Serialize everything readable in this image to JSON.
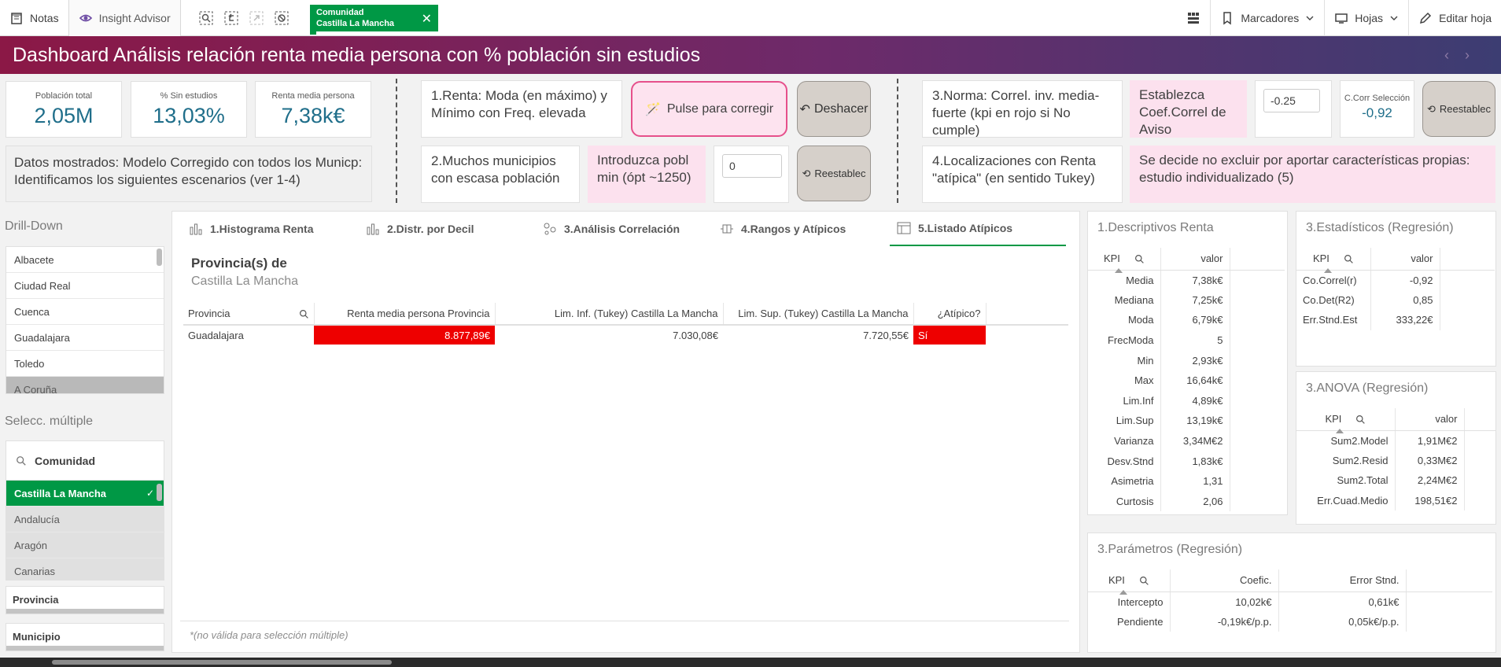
{
  "toolbar": {
    "notes_label": "Notas",
    "insight_label": "Insight Advisor",
    "selection_chip": {
      "field": "Comunidad",
      "value": "Castilla La Mancha"
    },
    "bookmarks_label": "Marcadores",
    "sheets_label": "Hojas",
    "edit_label": "Editar hoja"
  },
  "title": "Dashboard Análisis relación renta media persona con % población sin estudios",
  "kpis": [
    {
      "label": "Población total",
      "value": "2,05M"
    },
    {
      "label": "% Sin estudios",
      "value": "13,03%"
    },
    {
      "label": "Renta media persona",
      "value": "7,38k€"
    }
  ],
  "info_text": "Datos mostrados: Modelo Corregido con  todos los Municp: Identificamos los siguientes escenarios (ver 1-4)",
  "scenario1": {
    "text": "1.Renta: Moda (en máximo) y Mínimo con Freq. elevada",
    "button": "Pulse para corregir",
    "undo": "Deshacer"
  },
  "scenario2": {
    "text": "2.Muchos municipios con escasa población",
    "prompt": "Introduzca pobl min (ópt ~1250)",
    "input": "0",
    "reset": "Reestablec"
  },
  "scenario3": {
    "text": "3.Norma: Correl. inv. media-fuerte (kpi en rojo si No cumple)",
    "prompt": "Establezca Coef.Correl de Aviso",
    "input": "-0.25",
    "corr_label": "C.Corr Selección",
    "corr_value": "-0,92",
    "reset": "Reestablec"
  },
  "scenario4": {
    "text": "4.Localizaciones con Renta \"atípica\" (en sentido Tukey)",
    "note": "Se decide no excluir por aportar características propias: estudio individualizado (5)"
  },
  "drilldown": {
    "title": "Drill-Down",
    "items": [
      "Albacete",
      "Ciudad Real",
      "Cuenca",
      "Guadalajara",
      "Toledo",
      "A Coruña"
    ]
  },
  "multiselect": {
    "title": "Selecc. múltiple",
    "search_field": "Comunidad",
    "items": [
      "Castilla La Mancha",
      "Andalucía",
      "Aragón",
      "Canarias"
    ],
    "field_provincia": "Provincia",
    "field_municipio": "Municipio"
  },
  "tabs": [
    "1.Histograma Renta",
    "2.Distr. por Decil",
    "3.Análisis Correlación",
    "4.Rangos y Atípicos",
    "5.Listado Atípicos"
  ],
  "main_table": {
    "title": "Provincia(s) de",
    "subtitle": "Castilla La Mancha",
    "columns": [
      "Provincia",
      "Renta media persona Provincia",
      "Lim. Inf. (Tukey) Castilla La Mancha",
      "Lim. Sup. (Tukey) Castilla La Mancha",
      "¿Atípico?"
    ],
    "rows": [
      [
        "Guadalajara",
        "8.877,89€",
        "7.030,08€",
        "7.720,55€",
        "Sí"
      ]
    ],
    "footnote": "*(no válida para selección múltiple)"
  },
  "descriptivos": {
    "title": "1.Descriptivos Renta",
    "columns": [
      "KPI",
      "valor"
    ],
    "rows": [
      [
        "Media",
        "7,38k€"
      ],
      [
        "Mediana",
        "7,25k€"
      ],
      [
        "Moda",
        "6,79k€"
      ],
      [
        "FrecModa",
        "5"
      ],
      [
        "Min",
        "2,93k€"
      ],
      [
        "Max",
        "16,64k€"
      ],
      [
        "Lim.Inf",
        "4,89k€"
      ],
      [
        "Lim.Sup",
        "13,19k€"
      ],
      [
        "Varianza",
        "3,34M€2"
      ],
      [
        "Desv.Stnd",
        "1,83k€"
      ],
      [
        "Asimetria",
        "1,31"
      ],
      [
        "Curtosis",
        "2,06"
      ]
    ]
  },
  "estadisticos": {
    "title": "3.Estadísticos (Regresión)",
    "columns": [
      "KPI",
      "valor"
    ],
    "rows": [
      [
        "Co.Correl(r)",
        "-0,92"
      ],
      [
        "Co.Det(R2)",
        "0,85"
      ],
      [
        "Err.Stnd.Est",
        "333,22€"
      ]
    ]
  },
  "anova": {
    "title": "3.ANOVA (Regresión)",
    "columns": [
      "KPI",
      "valor"
    ],
    "rows": [
      [
        "Sum2.Model",
        "1,91M€2"
      ],
      [
        "Sum2.Resid",
        "0,33M€2"
      ],
      [
        "Sum2.Total",
        "2,24M€2"
      ],
      [
        "Err.Cuad.Medio",
        "198,51€2"
      ]
    ]
  },
  "parametros": {
    "title": "3.Parámetros (Regresión)",
    "columns": [
      "KPI",
      "Coefic.",
      "Error Stnd."
    ],
    "rows": [
      [
        "Intercepto",
        "10,02k€",
        "0,61k€"
      ],
      [
        "Pendiente",
        "-0,19k€/p.p.",
        "0,05k€/p.p."
      ]
    ]
  },
  "colors": {
    "accent_green": "#009845",
    "kpi_blue": "#1f6e8a",
    "alert_red": "#ee0000",
    "pink": "#fce1ee"
  }
}
